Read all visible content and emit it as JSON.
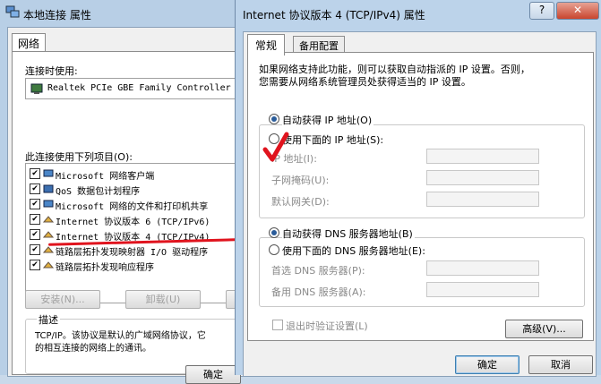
{
  "back_window": {
    "title": "本地连接 属性",
    "tab_network": "网络",
    "connect_using_label": "连接时使用:",
    "adapter_name": "Realtek PCIe GBE Family Controller",
    "items_label": "此连接使用下列项目(O):",
    "items": [
      {
        "label": "Microsoft 网络客户端",
        "checked": true,
        "icon": "network-client-icon"
      },
      {
        "label": "QoS 数据包计划程序",
        "checked": true,
        "icon": "qos-icon"
      },
      {
        "label": "Microsoft 网络的文件和打印机共享",
        "checked": true,
        "icon": "file-share-icon"
      },
      {
        "label": "Internet 协议版本 6 (TCP/IPv6)",
        "checked": true,
        "icon": "protocol-icon"
      },
      {
        "label": "Internet 协议版本 4 (TCP/IPv4)",
        "checked": true,
        "icon": "protocol-icon"
      },
      {
        "label": "链路层拓扑发现映射器 I/O 驱动程序",
        "checked": true,
        "icon": "protocol-icon"
      },
      {
        "label": "链路层拓扑发现响应程序",
        "checked": true,
        "icon": "protocol-icon"
      }
    ],
    "install_button": "安装(N)...",
    "uninstall_button": "卸载(U)",
    "description_label": "描述",
    "description_text_1": "TCP/IP。该协议是默认的广域网络协议，它",
    "description_text_2": "的相互连接的网络上的通讯。",
    "ok_button": "确定"
  },
  "front_window": {
    "title": "Internet 协议版本 4 (TCP/IPv4) 属性",
    "help_button": "?",
    "close_button": "✕",
    "tab_general": "常规",
    "tab_alternate": "备用配置",
    "intro_line_1": "如果网络支持此功能，则可以获取自动指派的 IP 设置。否则，",
    "intro_line_2": "您需要从网络系统管理员处获得适当的 IP 设置。",
    "auto_ip": "自动获得 IP 地址(O)",
    "manual_ip": "使用下面的 IP 地址(S):",
    "ip_address": "IP 地址(I):",
    "subnet_mask": "子网掩码(U):",
    "default_gateway": "默认网关(D):",
    "auto_dns": "自动获得 DNS 服务器地址(B)",
    "manual_dns": "使用下面的 DNS 服务器地址(E):",
    "preferred_dns": "首选 DNS 服务器(P):",
    "alternate_dns": "备用 DNS 服务器(A):",
    "validate_on_exit": "退出时验证设置(L)",
    "advanced_button": "高级(V)...",
    "ok_button": "确定",
    "cancel_button": "取消",
    "ip_selection": "auto",
    "dns_selection": "auto"
  },
  "annotations": {
    "checkmark_color": "#e0141e",
    "underline_color": "#e0141e"
  }
}
